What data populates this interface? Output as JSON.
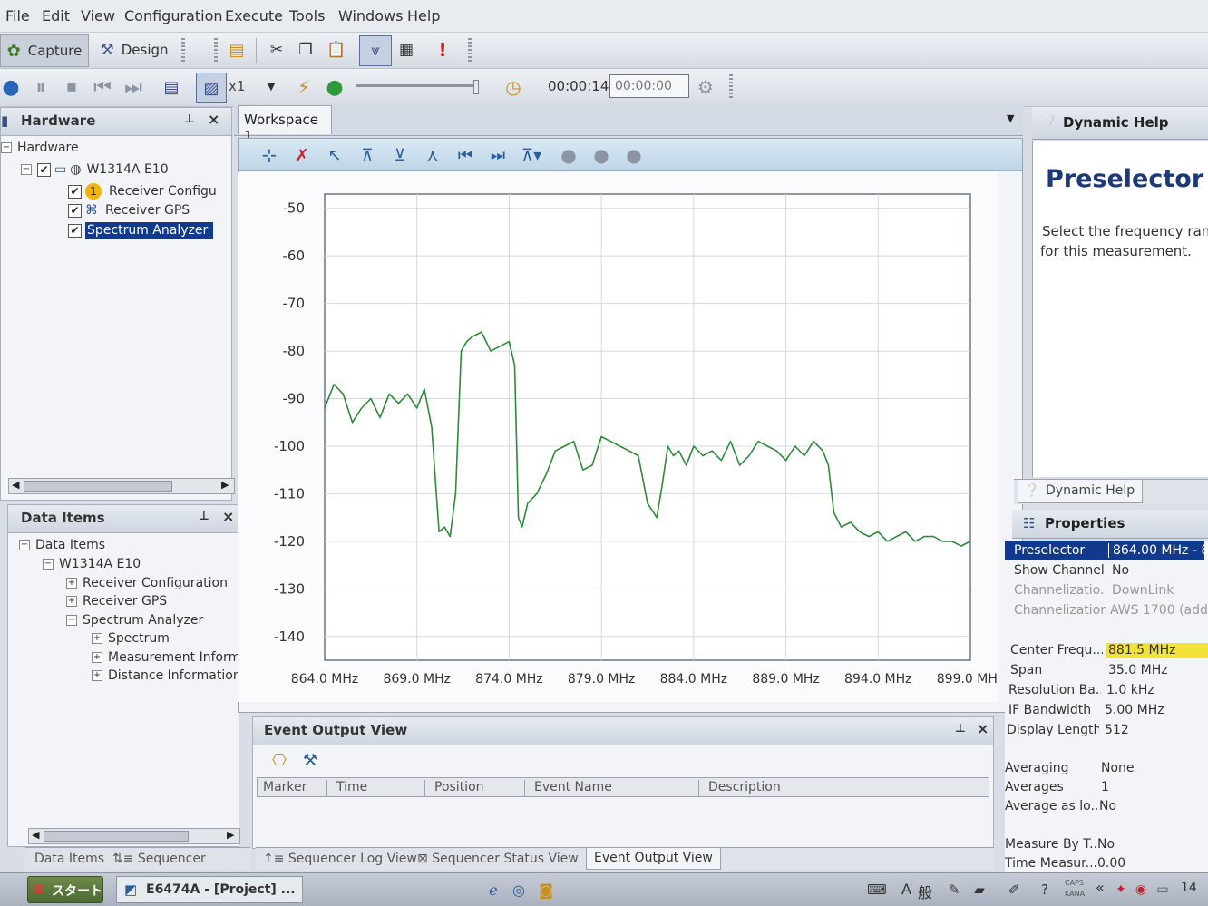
{
  "menu": [
    "File",
    "Edit",
    "View",
    "Configuration",
    "Execute",
    "Tools",
    "Windows",
    "Help"
  ],
  "toolbar": {
    "capture_label": "Capture",
    "design_label": "Design",
    "speed_value": "x1",
    "elapsed_time": "00:00:14",
    "time_field_value": "00:00:00"
  },
  "hardware_panel": {
    "title": "Hardware",
    "root": "Hardware",
    "device": "W1314A E10",
    "items": [
      "Receiver Configu",
      "Receiver GPS",
      "Spectrum Analyzer"
    ]
  },
  "data_items_panel": {
    "title": "Data Items",
    "root": "Data Items",
    "device": "W1314A E10",
    "items": [
      "Receiver Configuration",
      "Receiver GPS",
      "Spectrum Analyzer"
    ],
    "sub_items": [
      "Spectrum",
      "Measurement Inform",
      "Distance Information"
    ],
    "tabs": [
      "Data Items",
      "Sequencer"
    ]
  },
  "workspace": {
    "tab_label": "Workspace 1"
  },
  "chart_data": {
    "type": "line",
    "x_ticks": [
      "864.0 MHz",
      "869.0 MHz",
      "874.0 MHz",
      "879.0 MHz",
      "884.0 MHz",
      "889.0 MHz",
      "894.0 MHz",
      "899.0 MHz"
    ],
    "y_ticks": [
      "-50",
      "-60",
      "-70",
      "-80",
      "-90",
      "-100",
      "-110",
      "-120",
      "-130",
      "-140"
    ],
    "xlim": [
      864.0,
      899.0
    ],
    "ylim": [
      -145,
      -47
    ],
    "grid": true,
    "line_color": "#2f8a3a",
    "series": [
      {
        "x": [
          864.0,
          864.5,
          865.0,
          865.5,
          866.0,
          866.5,
          867.0,
          867.5,
          868.0,
          868.5,
          869.0,
          869.4,
          869.8,
          870.2,
          870.5,
          870.8,
          871.1,
          871.4,
          871.7,
          872.0,
          872.5,
          873.0,
          873.5,
          874.0,
          874.3,
          874.5,
          874.7,
          875.0,
          875.5,
          876.0,
          876.5,
          877.0,
          877.5,
          878.0,
          878.5,
          879.0,
          879.5,
          880.0,
          880.5,
          881.0,
          881.5,
          882.0,
          882.3,
          882.6,
          882.9,
          883.2,
          883.6,
          884.0,
          884.5,
          885.0,
          885.5,
          886.0,
          886.5,
          887.0,
          887.5,
          888.0,
          888.5,
          889.0,
          889.5,
          890.0,
          890.5,
          891.0,
          891.3,
          891.6,
          892.0,
          892.5,
          893.0,
          893.5,
          894.0,
          894.5,
          895.0,
          895.5,
          896.0,
          896.5,
          897.0,
          897.5,
          898.0,
          898.5,
          899.0
        ],
        "y": [
          -92,
          -87,
          -89,
          -95,
          -92,
          -90,
          -94,
          -89,
          -91,
          -89,
          -92,
          -88,
          -96,
          -118,
          -117,
          -119,
          -110,
          -80,
          -78,
          -77,
          -76,
          -80,
          -79,
          -78,
          -83,
          -115,
          -117,
          -112,
          -110,
          -106,
          -101,
          -100,
          -99,
          -105,
          -104,
          -98,
          -99,
          -100,
          -101,
          -102,
          -112,
          -115,
          -108,
          -100,
          -102,
          -101,
          -104,
          -100,
          -102,
          -101,
          -103,
          -99,
          -104,
          -102,
          -99,
          -100,
          -101,
          -103,
          -100,
          -102,
          -99,
          -101,
          -104,
          -114,
          -117,
          -116,
          -118,
          -119,
          -118,
          -120,
          -119,
          -118,
          -120,
          -119,
          -119,
          -120,
          -120,
          -121,
          -120
        ]
      }
    ]
  },
  "event_output": {
    "title": "Event Output View",
    "columns": [
      "Marker",
      "Time",
      "Position",
      "Event Name",
      "Description"
    ],
    "tabs": [
      "Sequencer Log View",
      "Sequencer Status View",
      "Event Output View"
    ]
  },
  "dynamic_help": {
    "title": "Dynamic Help",
    "heading": "Preselector",
    "body_line1": "Select the frequency ran",
    "body_line2": "for this measurement.",
    "tab_label": "Dynamic Help"
  },
  "properties": {
    "title": "Properties",
    "group1": [
      {
        "label": "Preselector",
        "value": "864.00 MHz - 8"
      },
      {
        "label": "Show Channel",
        "value": "No"
      },
      {
        "label": "Channelizatio...",
        "value": "DownLink"
      },
      {
        "label": "Channelization",
        "value": "AWS 1700 (add"
      }
    ],
    "group2": [
      {
        "label": "Center Frequ...",
        "value": "881.5 MHz"
      },
      {
        "label": "Span",
        "value": "35.0 MHz"
      },
      {
        "label": "Resolution Ba...",
        "value": "1.0 kHz"
      },
      {
        "label": "IF Bandwidth",
        "value": "5.00 MHz"
      },
      {
        "label": "Display Length",
        "value": "512"
      }
    ],
    "group3": [
      {
        "label": "Averaging",
        "value": "None"
      },
      {
        "label": "Averages",
        "value": "1"
      },
      {
        "label": "Average as lo...",
        "value": "No"
      }
    ],
    "group4": [
      {
        "label": "Measure By T...",
        "value": "No"
      },
      {
        "label": "Time Measur...",
        "value": "0.00"
      }
    ],
    "selected_color": "#123a8c",
    "highlight_color": "#f2e23a"
  },
  "taskbar": {
    "start_label": "スタート",
    "task_label": "E6474A - [Project] ...",
    "ime_a": "A",
    "ime_mode": "般",
    "tray_caps": "CAPS",
    "tray_kana": "KANA",
    "tray_arrows": "«",
    "clock": "14"
  }
}
